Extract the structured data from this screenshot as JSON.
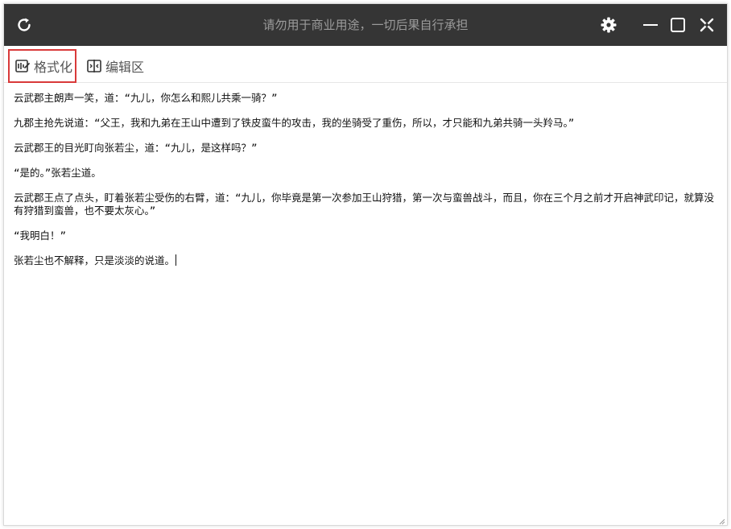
{
  "window": {
    "title": "请勿用于商业用途，一切后果自行承担",
    "icons": {
      "refresh": "refresh-icon",
      "settings": "gear-icon",
      "minimize": "minimize-icon",
      "maximize": "maximize-icon",
      "close": "close-icon"
    },
    "colors": {
      "titlebar_bg": "#353535",
      "title_text": "#9b9b9b",
      "highlight_border": "#d93a3a"
    }
  },
  "toolbar": {
    "tabs": [
      {
        "label": "格式化",
        "icon": "format-icon",
        "selected": true
      },
      {
        "label": "编辑区",
        "icon": "edit-area-icon",
        "selected": false
      }
    ]
  },
  "editor": {
    "paragraphs": [
      "云武郡主朗声一笑，道：“九儿，你怎么和熙儿共乘一骑？”",
      "九郡主抢先说道：“父王，我和九弟在王山中遭到了铁皮蛮牛的攻击，我的坐骑受了重伤，所以，才只能和九弟共骑一头羚马。”",
      "云武郡王的目光盯向张若尘，道：“九儿，是这样吗？”",
      "“是的。”张若尘道。",
      "云武郡王点了点头，盯着张若尘受伤的右臂，道：“九儿，你毕竟是第一次参加王山狩猎，第一次与蛮兽战斗，而且，你在三个月之前才开启神武印记，就算没有狩猎到蛮兽，也不要太灰心。”",
      "“我明白！”",
      "张若尘也不解释，只是淡淡的说道。"
    ]
  }
}
